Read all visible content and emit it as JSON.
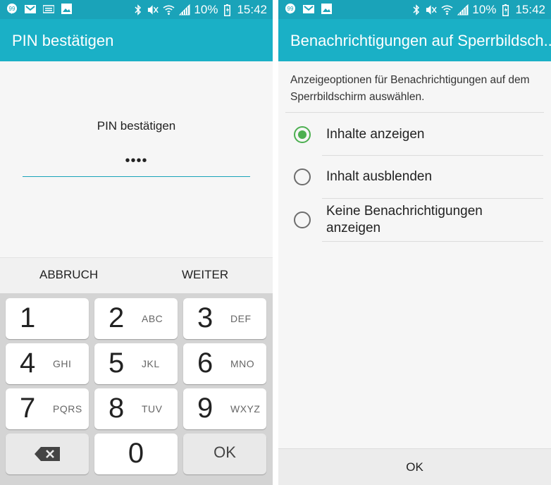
{
  "status_bar": {
    "battery_percent": "10%",
    "time": "15:42",
    "left_icons": [
      "hangouts-icon",
      "email-icon",
      "keyboard-icon",
      "gallery-icon"
    ],
    "right_icons": [
      "bluetooth-icon",
      "mute-icon",
      "wifi-icon",
      "signal-icon",
      "battery-icon"
    ]
  },
  "left_screen": {
    "title": "PIN bestätigen",
    "pin_label": "PIN bestätigen",
    "pin_masked": "••••",
    "cancel_label": "ABBRUCH",
    "next_label": "WEITER",
    "keys": [
      {
        "num": "1",
        "letters": ""
      },
      {
        "num": "2",
        "letters": "ABC"
      },
      {
        "num": "3",
        "letters": "DEF"
      },
      {
        "num": "4",
        "letters": "GHI"
      },
      {
        "num": "5",
        "letters": "JKL"
      },
      {
        "num": "6",
        "letters": "MNO"
      },
      {
        "num": "7",
        "letters": "PQRS"
      },
      {
        "num": "8",
        "letters": "TUV"
      },
      {
        "num": "9",
        "letters": "WXYZ"
      },
      {
        "num": "0",
        "letters": ""
      }
    ],
    "ok_key_label": "OK"
  },
  "right_screen": {
    "title": "Benachrichtigungen auf Sperrbildsch...",
    "description": "Anzeigeoptionen für Benachrichtigungen auf dem Sperrbildschirm auswählen.",
    "options": [
      {
        "label": "Inhalte anzeigen",
        "selected": true
      },
      {
        "label": "Inhalt ausblenden",
        "selected": false
      },
      {
        "label": "Keine Benachrichtigungen anzeigen",
        "selected": false
      }
    ],
    "ok_label": "OK"
  },
  "colors": {
    "status_bar": "#1aa3b9",
    "app_bar": "#1ab0c6",
    "radio_selected": "#4caf50",
    "keypad_background": "#d4d4d4"
  }
}
